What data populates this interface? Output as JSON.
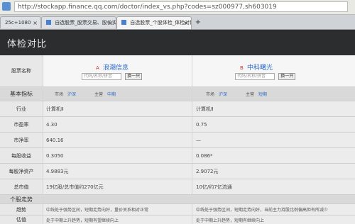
{
  "browser": {
    "url": "http://stockapp.finance.qq.com/doctor/index_vs.php?codes=sz000977,sh603019",
    "tabs": [
      {
        "label": "25c+1080"
      },
      {
        "label": "自选股票_股票交易、股价实时查"
      },
      {
        "label": "自选股票_个股体检_体检对比"
      }
    ],
    "new_tab": "+"
  },
  "header": {
    "title": "体检对比"
  },
  "stocks": {
    "a_mark": "A",
    "a_name": "浪潮信息",
    "b_mark": "B",
    "b_name": "中科曙光",
    "search_placeholder": "代码/名称/拼音",
    "change_label": "换一只"
  },
  "labels": {
    "select": "股票名称",
    "basic": "基本指标",
    "industry": "行业",
    "pe": "市盈率",
    "pb": "市净率",
    "eps": "每股收益",
    "bvps": "每股净资产",
    "mcap": "总市值",
    "detail": "个股走势",
    "trend": "趋势",
    "quote": "估值"
  },
  "rows": {
    "basic_a": [
      "市场",
      "沪深",
      "主营",
      "中期"
    ],
    "basic_b": [
      "市场",
      "沪深",
      "主营",
      "短期"
    ],
    "industry_a": "计算机Ⅱ",
    "industry_b": "计算机Ⅱ",
    "pe_a": "4.30",
    "pe_b": "0.75",
    "pb_a": "640.16",
    "pb_b": "—",
    "eps_a": "0.3050",
    "eps_b": "0.086*",
    "bvps_a": "4.9883元",
    "bvps_b": "2.9072元",
    "mcap_a": "19亿股/总市值约270亿元",
    "mcap_b": "10亿/约7亿流通",
    "trend_a": "中线处于强势区间，短期走势向好，量价关系相对正常",
    "trend_b": "中线处于强势区间，短期走势向好，当前主力持股比例偏高但有所减少",
    "quote_a": "处于中期上升趋势，短期有望继续向上",
    "quote_b": "处于中期上升趋势，短期有继续向上"
  }
}
